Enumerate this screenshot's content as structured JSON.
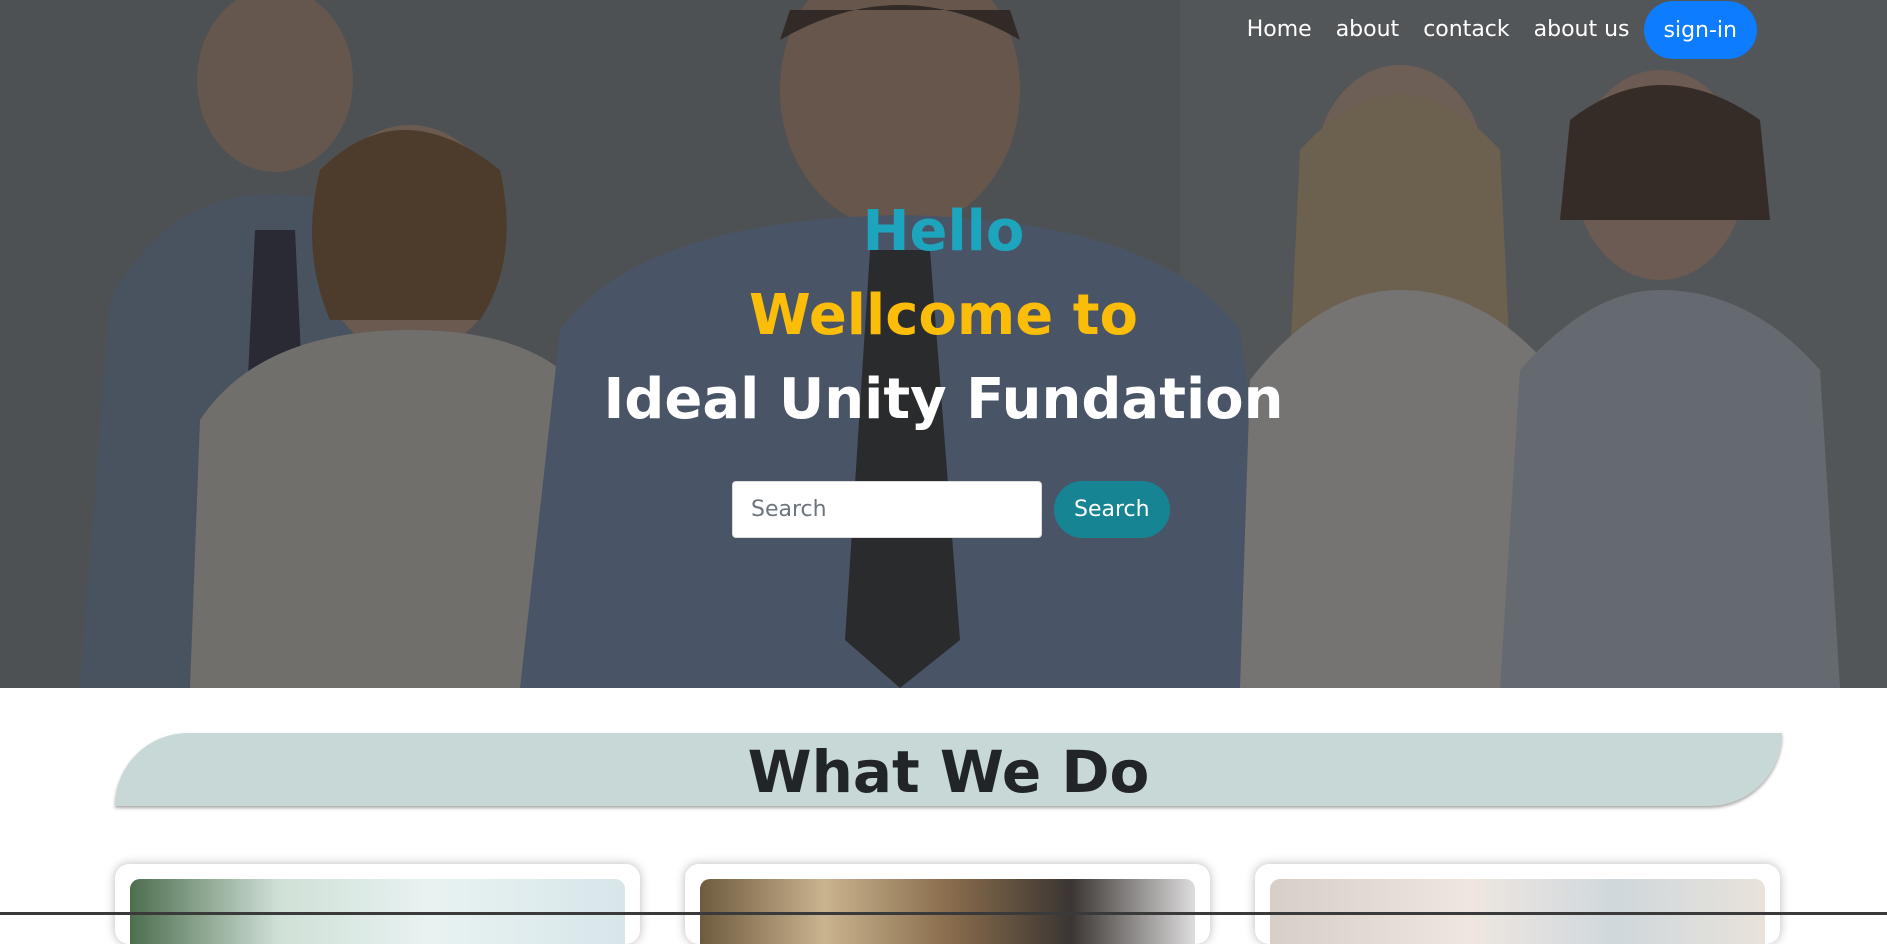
{
  "nav": {
    "items": [
      {
        "label": "Home"
      },
      {
        "label": "about"
      },
      {
        "label": "contack"
      },
      {
        "label": "about us"
      }
    ],
    "signin_label": "sign-in"
  },
  "hero": {
    "line1": "Hello",
    "line2": "Wellcome to",
    "line3": "Ideal Unity Fundation",
    "search": {
      "placeholder": "Search",
      "value": "",
      "button_label": "Search"
    }
  },
  "section": {
    "title": "What We Do"
  },
  "colors": {
    "hello": "#1ea5be",
    "welcome": "#fbbd08",
    "signin": "#0d7cff",
    "search_button": "#178494",
    "banner": "#c7d8d6"
  }
}
